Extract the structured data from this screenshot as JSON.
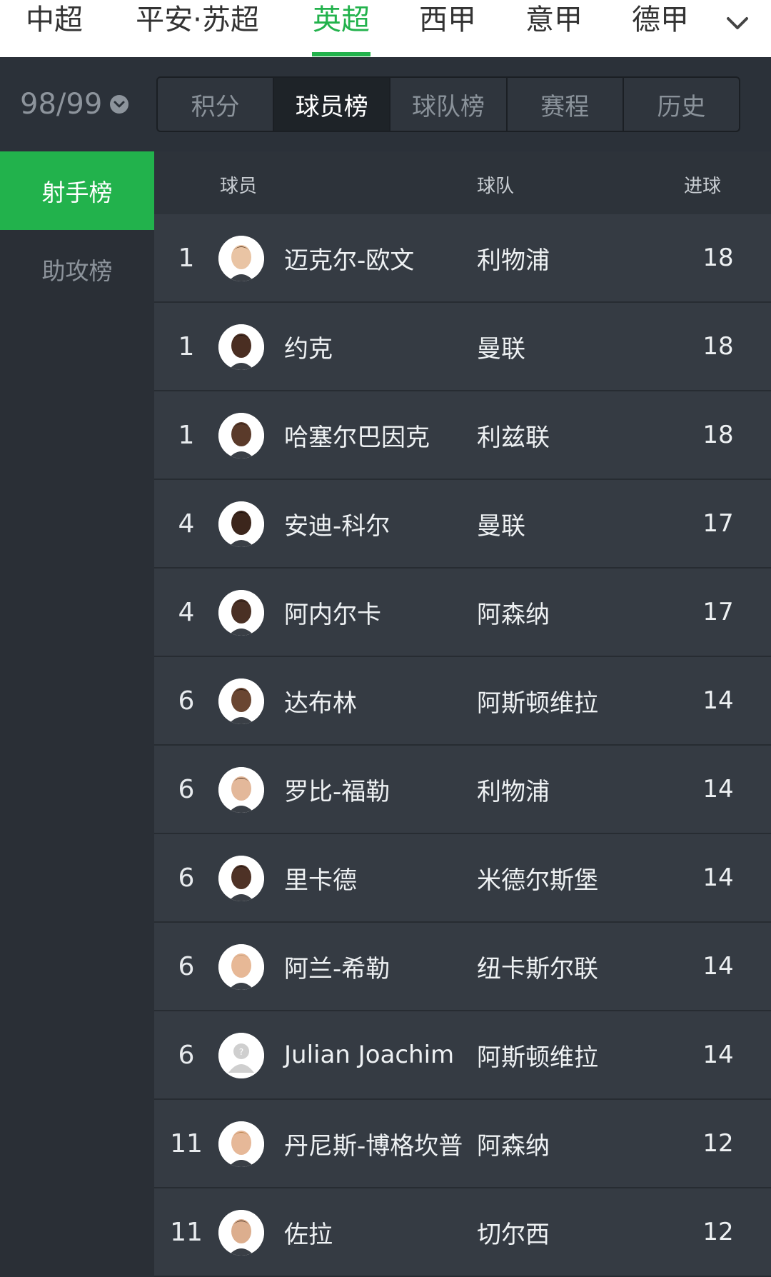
{
  "leagues": [
    {
      "label": "中超",
      "active": false
    },
    {
      "label": "平安·苏超",
      "active": false
    },
    {
      "label": "英超",
      "active": true
    },
    {
      "label": "西甲",
      "active": false
    },
    {
      "label": "意甲",
      "active": false
    },
    {
      "label": "德甲",
      "active": false
    }
  ],
  "more_icon": "chevron-down-icon",
  "season": {
    "label": "98/99",
    "icon": "chevron-circle-down-icon"
  },
  "segments": [
    {
      "label": "积分",
      "active": false
    },
    {
      "label": "球员榜",
      "active": true
    },
    {
      "label": "球队榜",
      "active": false
    },
    {
      "label": "赛程",
      "active": false
    },
    {
      "label": "历史",
      "active": false
    }
  ],
  "side_menu": [
    {
      "label": "射手榜",
      "active": true
    },
    {
      "label": "助攻榜",
      "active": false
    }
  ],
  "table": {
    "headers": {
      "player": "球员",
      "team": "球队",
      "goals": "进球"
    },
    "rows": [
      {
        "rank": "1",
        "player": "迈克尔-欧文",
        "team": "利物浦",
        "goals": "18",
        "skin": "#e9c4a4",
        "hair": "#5a3a22",
        "placeholder": false
      },
      {
        "rank": "1",
        "player": "约克",
        "team": "曼联",
        "goals": "18",
        "skin": "#4a2e22",
        "hair": "#1c1210",
        "placeholder": false
      },
      {
        "rank": "1",
        "player": "哈塞尔巴因克",
        "team": "利兹联",
        "goals": "18",
        "skin": "#5a3a2a",
        "hair": "#2a1a14",
        "placeholder": false
      },
      {
        "rank": "4",
        "player": "安迪-科尔",
        "team": "曼联",
        "goals": "17",
        "skin": "#3c261c",
        "hair": "#1a100c",
        "placeholder": false
      },
      {
        "rank": "4",
        "player": "阿内尔卡",
        "team": "阿森纳",
        "goals": "17",
        "skin": "#4a3024",
        "hair": "#1a100c",
        "placeholder": false
      },
      {
        "rank": "6",
        "player": "达布林",
        "team": "阿斯顿维拉",
        "goals": "14",
        "skin": "#6a4632",
        "hair": "#241610",
        "placeholder": false
      },
      {
        "rank": "6",
        "player": "罗比-福勒",
        "team": "利物浦",
        "goals": "14",
        "skin": "#e3b89a",
        "hair": "#4a2e1c",
        "placeholder": false
      },
      {
        "rank": "6",
        "player": "里卡德",
        "team": "米德尔斯堡",
        "goals": "14",
        "skin": "#4e3226",
        "hair": "#1c120e",
        "placeholder": false
      },
      {
        "rank": "6",
        "player": "阿兰-希勒",
        "team": "纽卡斯尔联",
        "goals": "14",
        "skin": "#e7b896",
        "hair": "#c8a07e",
        "placeholder": false
      },
      {
        "rank": "6",
        "player": "Julian Joachim",
        "team": "阿斯顿维拉",
        "goals": "14",
        "skin": "#d6d6d6",
        "hair": "#d6d6d6",
        "placeholder": true
      },
      {
        "rank": "11",
        "player": "丹尼斯-博格坎普",
        "team": "阿森纳",
        "goals": "12",
        "skin": "#e6b898",
        "hair": "#b9824e",
        "placeholder": false
      },
      {
        "rank": "11",
        "player": "佐拉",
        "team": "切尔西",
        "goals": "12",
        "skin": "#dcae8e",
        "hair": "#3a2618",
        "placeholder": false
      }
    ]
  }
}
